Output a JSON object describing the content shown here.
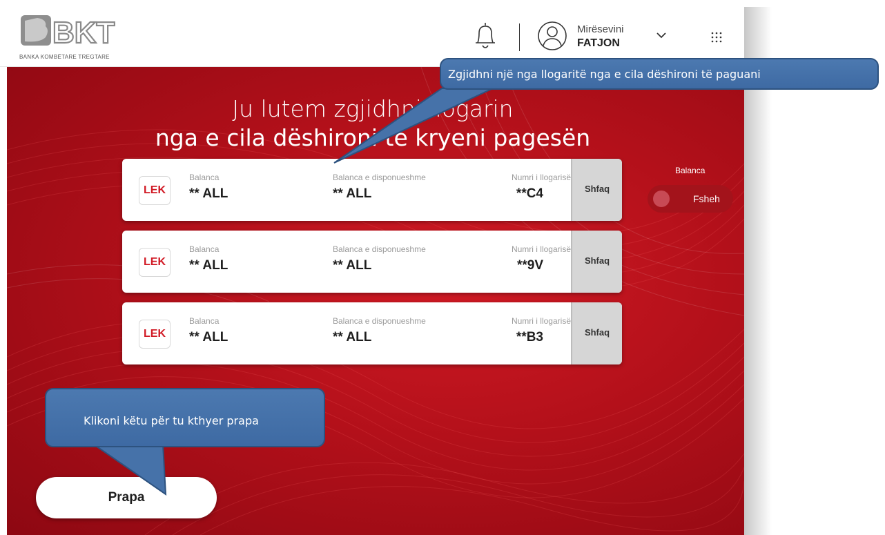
{
  "header": {
    "logo_text": "BKT",
    "logo_subtitle": "BANKA KOMBËTARE TREGTARE",
    "greeting": "Mirësevini",
    "user_name": "FATJON"
  },
  "main": {
    "title_line1": "Ju lutem zgjidhni llogarin",
    "title_line2": "nga e cila dëshironi të kryeni pagesën",
    "accounts": [
      {
        "currency_badge": "LEK",
        "balance_label": "Balanca",
        "balance_value": "** ALL",
        "available_label": "Balanca e disponueshme",
        "available_value": "** ALL",
        "account_label": "Numri i llogarisë",
        "account_value": "**C4",
        "show_label": "Shfaq"
      },
      {
        "currency_badge": "LEK",
        "balance_label": "Balanca",
        "balance_value": "** ALL",
        "available_label": "Balanca e disponueshme",
        "available_value": "** ALL",
        "account_label": "Numri i llogarisë",
        "account_value": "**9V",
        "show_label": "Shfaq"
      },
      {
        "currency_badge": "LEK",
        "balance_label": "Balanca",
        "balance_value": "** ALL",
        "available_label": "Balanca e disponueshme",
        "available_value": "** ALL",
        "account_label": "Numri i llogarisë",
        "account_value": "**B3",
        "show_label": "Shfaq"
      }
    ],
    "balance_toggle": {
      "label": "Balanca",
      "state_text": "Fsheh"
    },
    "back_button": "Prapa"
  },
  "tooltips": {
    "select_account": "Zgjidhni një nga llogaritë nga e cila dëshironi të paguani",
    "go_back": "Klikoni këtu për tu kthyer prapa"
  },
  "colors": {
    "brand_red": "#c8141e",
    "callout_blue": "#4472a8",
    "badge_red": "#d11a25"
  }
}
